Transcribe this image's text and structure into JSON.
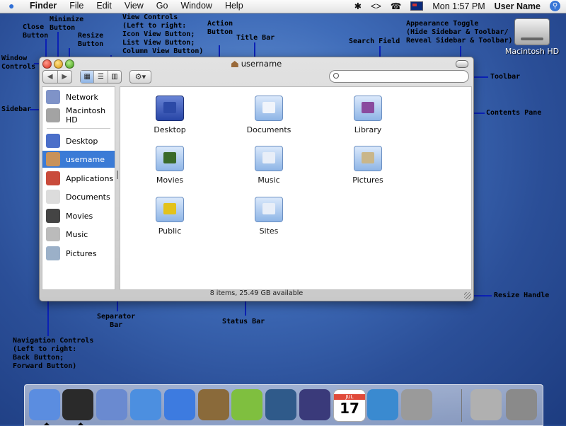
{
  "menubar": {
    "apple_glyph": "",
    "menus": [
      "Finder",
      "File",
      "Edit",
      "View",
      "Go",
      "Window",
      "Help"
    ],
    "clock": "Mon 1:57 PM",
    "user": "User Name",
    "status_icons": [
      "bluetooth-icon",
      "sync-icon",
      "phone-icon",
      "flag-icon",
      "spotlight-icon"
    ]
  },
  "desktop": {
    "hd_label": "Macintosh HD"
  },
  "annotations": {
    "close": "Close\nButton",
    "minimize": "Minimize\nButton",
    "resize": "Resize\nButton",
    "window_controls": "Window\nControls",
    "view_controls": "View Controls\n(Left to right:\nIcon View Button;\nList View Button;\nColumn View Button)",
    "action": "Action\nButton",
    "title_bar": "Title Bar",
    "search": "Search Field",
    "appearance": "Appearance Toggle\n(Hide Sidebar & Toolbar/\nReveal Sidebar & Toolbar)",
    "toolbar": "Toolbar",
    "sidebar": "Sidebar",
    "contents": "Contents Pane",
    "resize_handle": "Resize Handle",
    "separator": "Separator\nBar",
    "status_bar": "Status Bar",
    "navigation": "Navigation Controls\n(Left to right:\nBack Button;\nForward Button)"
  },
  "window": {
    "title": "username",
    "status": "8 items, 25.49 GB available"
  },
  "sidebar": {
    "items": [
      {
        "label": "Network",
        "color": "#7f93c8"
      },
      {
        "label": "Macintosh HD",
        "color": "#a3a3a3"
      },
      {
        "label": "Desktop",
        "color": "#4b6fc9"
      },
      {
        "label": "username",
        "color": "#c8925a"
      },
      {
        "label": "Applications",
        "color": "#c94b3b"
      },
      {
        "label": "Documents",
        "color": "#dcdcdc"
      },
      {
        "label": "Movies",
        "color": "#444444"
      },
      {
        "label": "Music",
        "color": "#bbbbbb"
      },
      {
        "label": "Pictures",
        "color": "#9bb0c8"
      }
    ],
    "selected_index": 3
  },
  "contents": {
    "folders": [
      {
        "label": "Desktop",
        "emblem": "#2c4aa7"
      },
      {
        "label": "Documents",
        "emblem": "#f0f4fb"
      },
      {
        "label": "Library",
        "emblem": "#8a4b9e"
      },
      {
        "label": "Movies",
        "emblem": "#3a6a2a"
      },
      {
        "label": "Music",
        "emblem": "#e8eef8"
      },
      {
        "label": "Pictures",
        "emblem": "#c9b68a"
      },
      {
        "label": "Public",
        "emblem": "#e3c21b"
      },
      {
        "label": "Sites",
        "emblem": "#e8eef8"
      }
    ]
  },
  "dock": {
    "apps": [
      {
        "name": "finder-icon",
        "color": "#5b8de0"
      },
      {
        "name": "dashboard-icon",
        "color": "#2a2a2a"
      },
      {
        "name": "mail-icon",
        "color": "#6a8ad0"
      },
      {
        "name": "safari-icon",
        "color": "#4c8fe0"
      },
      {
        "name": "ichat-icon",
        "color": "#3d7be0"
      },
      {
        "name": "address-book-icon",
        "color": "#8a6a3a"
      },
      {
        "name": "itunes-icon",
        "color": "#7fbf3f"
      },
      {
        "name": "iphoto-icon",
        "color": "#2f5a8a"
      },
      {
        "name": "imovie-icon",
        "color": "#3a3a7a"
      },
      {
        "name": "ical-icon",
        "color": "#e04a3a"
      },
      {
        "name": "quicktime-icon",
        "color": "#3a8ad0"
      },
      {
        "name": "system-preferences-icon",
        "color": "#9a9a9a"
      },
      {
        "name": "network-utility-icon",
        "color": "#b0b0b0"
      },
      {
        "name": "trash-icon",
        "color": "#8a8a8a"
      }
    ],
    "calendar_day": "17",
    "calendar_month": "JUL"
  }
}
